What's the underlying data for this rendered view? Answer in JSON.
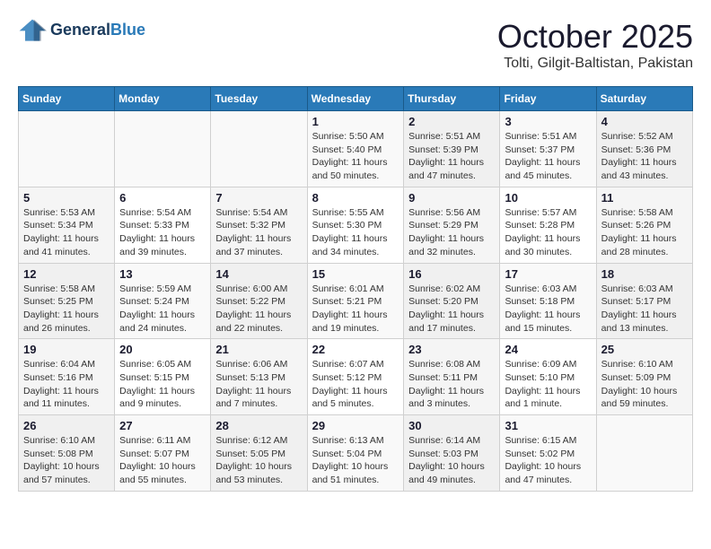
{
  "header": {
    "logo_line1": "General",
    "logo_line2": "Blue",
    "month": "October 2025",
    "location": "Tolti, Gilgit-Baltistan, Pakistan"
  },
  "days_of_week": [
    "Sunday",
    "Monday",
    "Tuesday",
    "Wednesday",
    "Thursday",
    "Friday",
    "Saturday"
  ],
  "weeks": [
    [
      {
        "day": "",
        "sunrise": "",
        "sunset": "",
        "daylight": ""
      },
      {
        "day": "",
        "sunrise": "",
        "sunset": "",
        "daylight": ""
      },
      {
        "day": "",
        "sunrise": "",
        "sunset": "",
        "daylight": ""
      },
      {
        "day": "1",
        "sunrise": "Sunrise: 5:50 AM",
        "sunset": "Sunset: 5:40 PM",
        "daylight": "Daylight: 11 hours and 50 minutes."
      },
      {
        "day": "2",
        "sunrise": "Sunrise: 5:51 AM",
        "sunset": "Sunset: 5:39 PM",
        "daylight": "Daylight: 11 hours and 47 minutes."
      },
      {
        "day": "3",
        "sunrise": "Sunrise: 5:51 AM",
        "sunset": "Sunset: 5:37 PM",
        "daylight": "Daylight: 11 hours and 45 minutes."
      },
      {
        "day": "4",
        "sunrise": "Sunrise: 5:52 AM",
        "sunset": "Sunset: 5:36 PM",
        "daylight": "Daylight: 11 hours and 43 minutes."
      }
    ],
    [
      {
        "day": "5",
        "sunrise": "Sunrise: 5:53 AM",
        "sunset": "Sunset: 5:34 PM",
        "daylight": "Daylight: 11 hours and 41 minutes."
      },
      {
        "day": "6",
        "sunrise": "Sunrise: 5:54 AM",
        "sunset": "Sunset: 5:33 PM",
        "daylight": "Daylight: 11 hours and 39 minutes."
      },
      {
        "day": "7",
        "sunrise": "Sunrise: 5:54 AM",
        "sunset": "Sunset: 5:32 PM",
        "daylight": "Daylight: 11 hours and 37 minutes."
      },
      {
        "day": "8",
        "sunrise": "Sunrise: 5:55 AM",
        "sunset": "Sunset: 5:30 PM",
        "daylight": "Daylight: 11 hours and 34 minutes."
      },
      {
        "day": "9",
        "sunrise": "Sunrise: 5:56 AM",
        "sunset": "Sunset: 5:29 PM",
        "daylight": "Daylight: 11 hours and 32 minutes."
      },
      {
        "day": "10",
        "sunrise": "Sunrise: 5:57 AM",
        "sunset": "Sunset: 5:28 PM",
        "daylight": "Daylight: 11 hours and 30 minutes."
      },
      {
        "day": "11",
        "sunrise": "Sunrise: 5:58 AM",
        "sunset": "Sunset: 5:26 PM",
        "daylight": "Daylight: 11 hours and 28 minutes."
      }
    ],
    [
      {
        "day": "12",
        "sunrise": "Sunrise: 5:58 AM",
        "sunset": "Sunset: 5:25 PM",
        "daylight": "Daylight: 11 hours and 26 minutes."
      },
      {
        "day": "13",
        "sunrise": "Sunrise: 5:59 AM",
        "sunset": "Sunset: 5:24 PM",
        "daylight": "Daylight: 11 hours and 24 minutes."
      },
      {
        "day": "14",
        "sunrise": "Sunrise: 6:00 AM",
        "sunset": "Sunset: 5:22 PM",
        "daylight": "Daylight: 11 hours and 22 minutes."
      },
      {
        "day": "15",
        "sunrise": "Sunrise: 6:01 AM",
        "sunset": "Sunset: 5:21 PM",
        "daylight": "Daylight: 11 hours and 19 minutes."
      },
      {
        "day": "16",
        "sunrise": "Sunrise: 6:02 AM",
        "sunset": "Sunset: 5:20 PM",
        "daylight": "Daylight: 11 hours and 17 minutes."
      },
      {
        "day": "17",
        "sunrise": "Sunrise: 6:03 AM",
        "sunset": "Sunset: 5:18 PM",
        "daylight": "Daylight: 11 hours and 15 minutes."
      },
      {
        "day": "18",
        "sunrise": "Sunrise: 6:03 AM",
        "sunset": "Sunset: 5:17 PM",
        "daylight": "Daylight: 11 hours and 13 minutes."
      }
    ],
    [
      {
        "day": "19",
        "sunrise": "Sunrise: 6:04 AM",
        "sunset": "Sunset: 5:16 PM",
        "daylight": "Daylight: 11 hours and 11 minutes."
      },
      {
        "day": "20",
        "sunrise": "Sunrise: 6:05 AM",
        "sunset": "Sunset: 5:15 PM",
        "daylight": "Daylight: 11 hours and 9 minutes."
      },
      {
        "day": "21",
        "sunrise": "Sunrise: 6:06 AM",
        "sunset": "Sunset: 5:13 PM",
        "daylight": "Daylight: 11 hours and 7 minutes."
      },
      {
        "day": "22",
        "sunrise": "Sunrise: 6:07 AM",
        "sunset": "Sunset: 5:12 PM",
        "daylight": "Daylight: 11 hours and 5 minutes."
      },
      {
        "day": "23",
        "sunrise": "Sunrise: 6:08 AM",
        "sunset": "Sunset: 5:11 PM",
        "daylight": "Daylight: 11 hours and 3 minutes."
      },
      {
        "day": "24",
        "sunrise": "Sunrise: 6:09 AM",
        "sunset": "Sunset: 5:10 PM",
        "daylight": "Daylight: 11 hours and 1 minute."
      },
      {
        "day": "25",
        "sunrise": "Sunrise: 6:10 AM",
        "sunset": "Sunset: 5:09 PM",
        "daylight": "Daylight: 10 hours and 59 minutes."
      }
    ],
    [
      {
        "day": "26",
        "sunrise": "Sunrise: 6:10 AM",
        "sunset": "Sunset: 5:08 PM",
        "daylight": "Daylight: 10 hours and 57 minutes."
      },
      {
        "day": "27",
        "sunrise": "Sunrise: 6:11 AM",
        "sunset": "Sunset: 5:07 PM",
        "daylight": "Daylight: 10 hours and 55 minutes."
      },
      {
        "day": "28",
        "sunrise": "Sunrise: 6:12 AM",
        "sunset": "Sunset: 5:05 PM",
        "daylight": "Daylight: 10 hours and 53 minutes."
      },
      {
        "day": "29",
        "sunrise": "Sunrise: 6:13 AM",
        "sunset": "Sunset: 5:04 PM",
        "daylight": "Daylight: 10 hours and 51 minutes."
      },
      {
        "day": "30",
        "sunrise": "Sunrise: 6:14 AM",
        "sunset": "Sunset: 5:03 PM",
        "daylight": "Daylight: 10 hours and 49 minutes."
      },
      {
        "day": "31",
        "sunrise": "Sunrise: 6:15 AM",
        "sunset": "Sunset: 5:02 PM",
        "daylight": "Daylight: 10 hours and 47 minutes."
      },
      {
        "day": "",
        "sunrise": "",
        "sunset": "",
        "daylight": ""
      }
    ]
  ]
}
